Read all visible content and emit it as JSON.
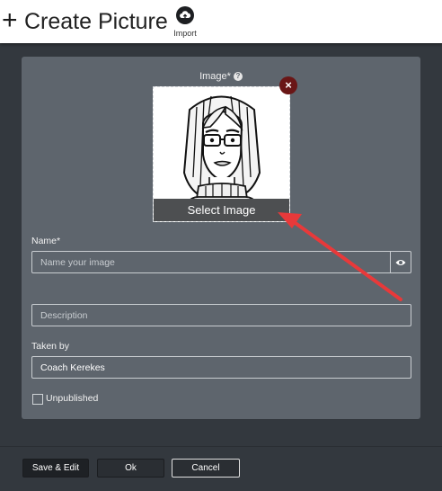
{
  "header": {
    "title": "Create Picture",
    "plus_glyph": "+",
    "import_label": "Import",
    "import_icon": "cloud-upload-icon"
  },
  "form": {
    "image_label": "Image*",
    "help_glyph": "?",
    "remove_glyph": "×",
    "select_image_label": "Select Image",
    "name_label": "Name*",
    "name_placeholder": "Name your image",
    "name_value": "",
    "description_placeholder": "Description",
    "description_value": "",
    "taken_by_label": "Taken by",
    "taken_by_value": "Coach Kerekes",
    "unpublished_label": "Unpublished",
    "unpublished_checked": false
  },
  "footer": {
    "save_edit_label": "Save & Edit",
    "ok_label": "Ok",
    "cancel_label": "Cancel"
  },
  "colors": {
    "background": "#33383e",
    "card": "#5e656d",
    "remove_button": "#6a1616",
    "annotation_arrow": "#e8393a"
  }
}
